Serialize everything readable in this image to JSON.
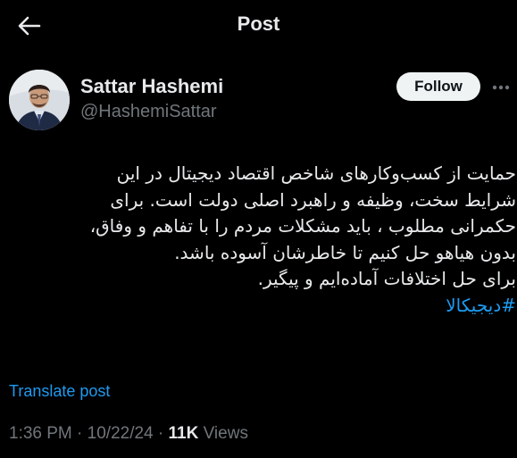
{
  "header": {
    "title": "Post",
    "back_icon": "arrow-left-icon"
  },
  "author": {
    "name": "Sattar Hashemi",
    "handle": "@HashemiSattar",
    "follow_label": "Follow",
    "more_icon": "more-options-icon"
  },
  "post": {
    "lines": [
      "حمایت از کسب‌وکارهای شاخص اقتصاد دیجیتال در این",
      "شرایط سخت، وظیفه و راهبرد اصلی دولت است. برای",
      "حکمرانی مطلوب ، باید مشکلات مردم را با تفاهم و وفاق،",
      "بدون هیاهو حل کنیم تا خاطرشان آسوده باشد.",
      "برای حل اختلافات آماده‌ایم و پیگیر."
    ],
    "hashtag": "#دیجیکالا",
    "translate_label": "Translate post"
  },
  "meta": {
    "time": "1:36 PM",
    "sep1": " · ",
    "date": "10/22/24",
    "sep2": " · ",
    "views_count": "11K",
    "views_label": " Views"
  },
  "colors": {
    "background": "#000000",
    "text": "#e7e9ea",
    "muted": "#71767b",
    "link": "#1d9bf0",
    "follow_bg": "#eff3f4"
  }
}
